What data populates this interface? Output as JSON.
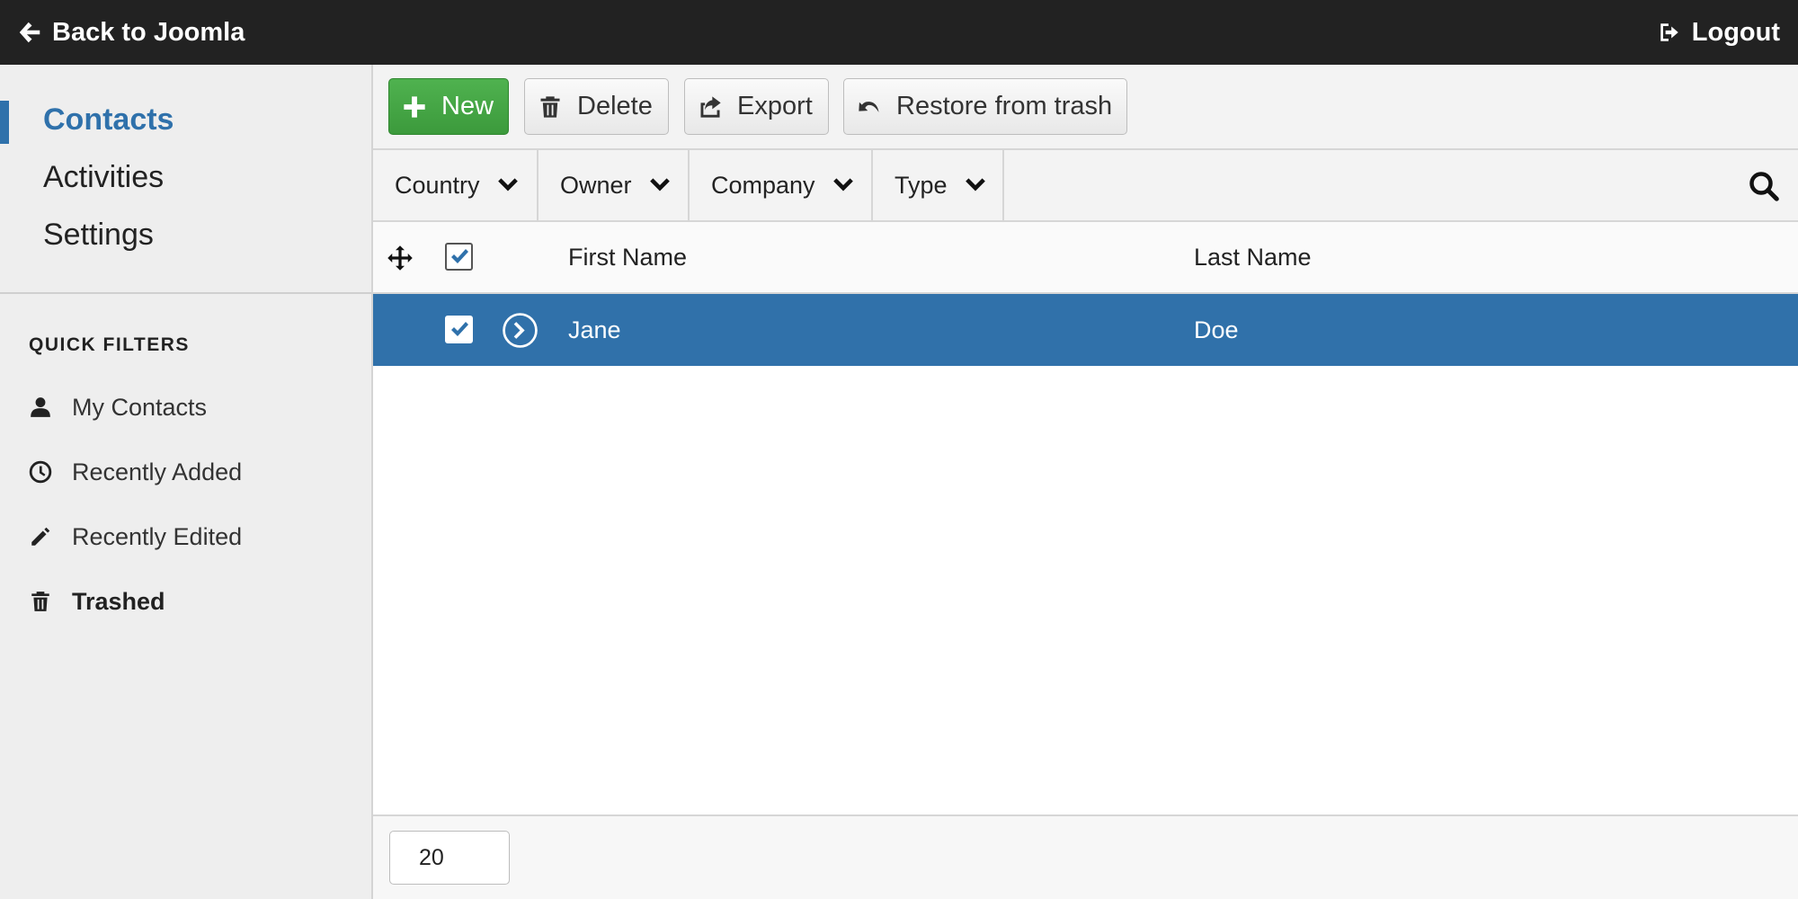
{
  "topbar": {
    "back_label": "Back to Joomla",
    "logout_label": "Logout"
  },
  "sidebar": {
    "nav": [
      {
        "label": "Contacts",
        "active": true
      },
      {
        "label": "Activities",
        "active": false
      },
      {
        "label": "Settings",
        "active": false
      }
    ],
    "quick_filters_title": "QUICK FILTERS",
    "quick_filters": [
      {
        "label": "My Contacts",
        "icon": "user-icon"
      },
      {
        "label": "Recently Added",
        "icon": "clock-icon"
      },
      {
        "label": "Recently Edited",
        "icon": "pencil-icon"
      },
      {
        "label": "Trashed",
        "icon": "trash-icon",
        "selected": true
      }
    ]
  },
  "toolbar": {
    "new_label": "New",
    "delete_label": "Delete",
    "export_label": "Export",
    "restore_label": "Restore from trash"
  },
  "filters": [
    {
      "label": "Country"
    },
    {
      "label": "Owner"
    },
    {
      "label": "Company"
    },
    {
      "label": "Type"
    }
  ],
  "table": {
    "columns": [
      "First Name",
      "Last Name"
    ],
    "rows": [
      {
        "first_name": "Jane",
        "last_name": "Doe",
        "selected": true
      }
    ]
  },
  "pagination": {
    "page_size": "20"
  },
  "colors": {
    "accent": "#2f71ab",
    "selected_row": "#3071aa",
    "new_button": "#46a546",
    "topbar": "#222222"
  }
}
